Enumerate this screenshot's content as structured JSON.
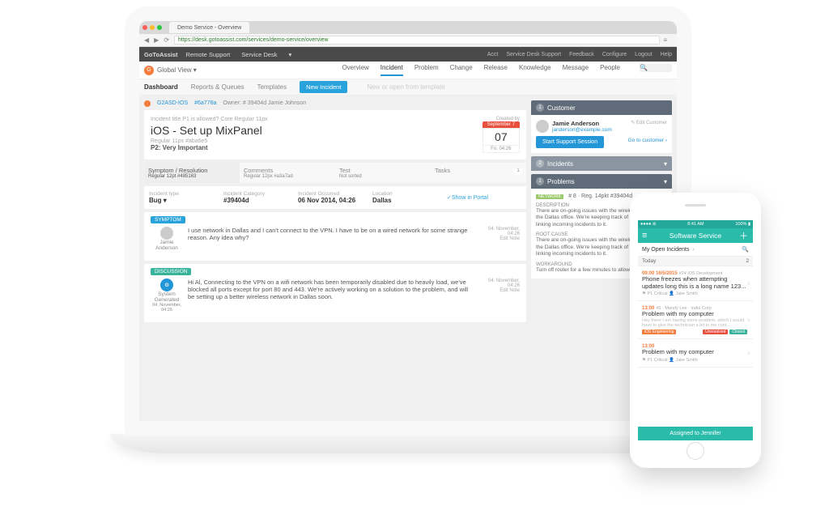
{
  "browser": {
    "tab_title": "Demo Service - Overview",
    "url": "https://desk.gotoassist.com/services/demo-service/overview"
  },
  "topbar": {
    "brand": "GoToAssist",
    "menu": [
      "Remote Support",
      "Service Desk"
    ],
    "right": [
      "Acct",
      "Service Desk Support",
      "Feedback",
      "Configure",
      "Logout",
      "Help"
    ]
  },
  "subhead": {
    "org_initial": "G",
    "org_name": "Global View",
    "tabs": [
      "Overview",
      "Incident",
      "Problem",
      "Change",
      "Release",
      "Knowledge",
      "Message",
      "People"
    ],
    "active_tab": "Incident"
  },
  "toolbar": {
    "items": [
      "Dashboard",
      "Reports & Queues",
      "Templates"
    ],
    "active": "Dashboard",
    "new_btn": "New Incident",
    "hint": "New or open from template"
  },
  "crumbs": {
    "a": "G2ASD-IOS",
    "b": "#6a778a",
    "owner": "Owner: # 39404d Jamie Johnson"
  },
  "incident": {
    "breadcrumb": "Incident title P1 is allowed? Core Regular 11px",
    "title": "iOS - Set up MixPanel",
    "subtitle": "Regular 11px #aba6e5",
    "priority": "P2: Very Important",
    "posted_by": "Created by",
    "date_month": "September  7",
    "date_day": "07",
    "date_foot": "Fri. 04:26"
  },
  "detail_tabs": {
    "symptom": {
      "label": "Symptom / Resolution",
      "sub": "Regular 12pt #485163"
    },
    "comments": {
      "label": "Comments",
      "sub": "Regular 12px #a3a7ad"
    },
    "test": {
      "label": "Test",
      "sub": "Not sorted"
    },
    "tasks": {
      "label": "Tasks",
      "count": "1"
    }
  },
  "meta": {
    "type": {
      "lbl": "Incident type",
      "val": "Bug"
    },
    "cat": {
      "lbl": "Incident Category",
      "val": "#39404d"
    },
    "occurred": {
      "lbl": "Incident Occurred",
      "val": "06 Nov 2014, 04:26"
    },
    "location": {
      "lbl": "Location",
      "val": "Dallas"
    },
    "show_portal": "Show in Portal"
  },
  "sections": {
    "symptom_label": "SYMPTOM",
    "discussion_label": "DISCUSSION"
  },
  "messages": {
    "user": {
      "name": "Jamie Anderson",
      "text": "I use network in Dallas and I can't connect to the VPN. I have to be on a wired network for some strange reason. Any idea why?",
      "ts": "04. November, 04:26",
      "edit": "Edit Note"
    },
    "system": {
      "name": "System Generated",
      "text": "Hi Al, Connecting to the VPN on a wifi network has been temporarily disabled due to heavily load, we've blocked all ports except for port 80 and 443. We're actively working on a solution to the problem, and will be setting up a better wireless network in Dallas soon.",
      "ts": "04. November, 04:26",
      "edit": "Edit Note"
    }
  },
  "customer": {
    "head": "Customer",
    "num": "1",
    "name": "Jamie Anderson",
    "email": "janderson@example.com",
    "edit": "Edit Customer",
    "start": "Start Support Session",
    "goto": "Go to customer ›"
  },
  "incidents_section": {
    "head": "Incidents",
    "num": "2"
  },
  "problems": {
    "head": "Problems",
    "num": "1",
    "tag": "NETWORK",
    "ref": "# 8  ·  Reg. 14pkt #39404d",
    "desc_lbl": "DESCRIPTION",
    "desc_txt": "There are on-going issues with the wireless network in the Dallas office. We're keeping track of this problem by linking incoming incidents to it.",
    "root_lbl": "ROOT CAUSE",
    "root_txt": "There are on-going issues with the wireless network in the Dallas office. We're keeping track of this problem by linking incoming incidents to it.",
    "work_lbl": "WORKAROUND",
    "work_txt": "Turn off router for a few minutes to allow cooldown."
  },
  "phone": {
    "status_time": "8:41 AM",
    "status_batt": "100%",
    "title": "Software Service",
    "filter": "My Open Incidents",
    "today": "Today",
    "today_count": "2",
    "assignbar": "Assigned to Jennifer",
    "items": [
      {
        "time": "09:00 16/5/2015",
        "cat": "#24 iOS Development",
        "title": "Phone freezes when attempting updates long this is a long name 123...",
        "meta1": "P1 Critical",
        "meta2": "Jake Smith"
      },
      {
        "time": "13:00",
        "cat": "#5 · Mandy Lee · India Corp",
        "title": "Problem with my computer",
        "sub": "Hey there I am having some problem, which I would have to give the technician a bit to me cont...",
        "tag1": "iOS Engineering",
        "tag2": "Unresolved",
        "tag3": "Closed"
      },
      {
        "time": "13:00",
        "title": "Problem with my computer",
        "meta1": "P1 Critical",
        "meta2": "Jake Smith"
      }
    ]
  }
}
